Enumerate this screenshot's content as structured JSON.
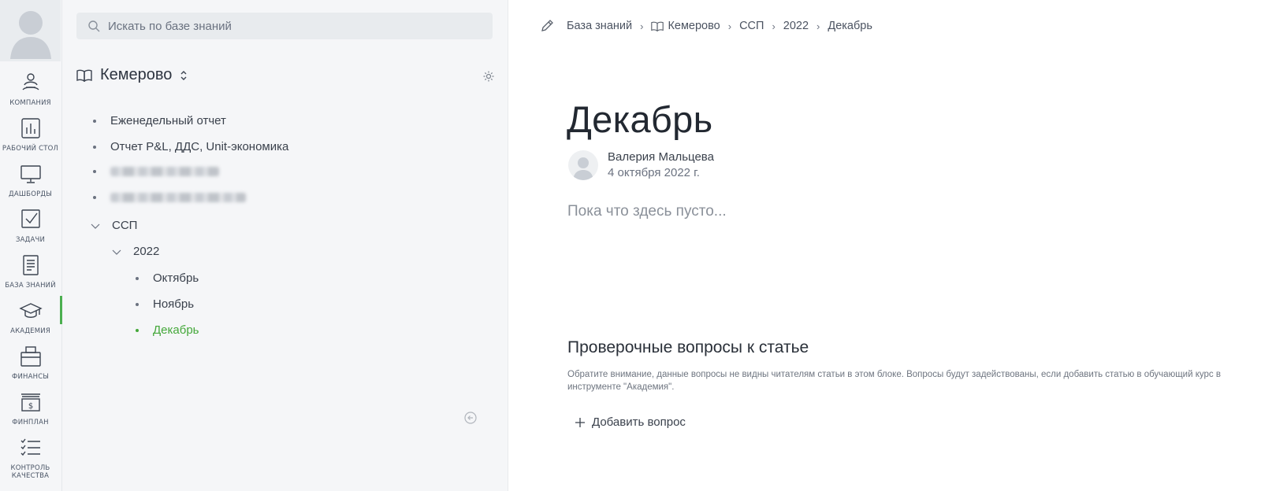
{
  "rail": {
    "items": [
      {
        "label": "КОМПАНИЯ",
        "icon": "company-icon"
      },
      {
        "label": "РАБОЧИЙ СТОЛ",
        "icon": "desktop-chart-icon"
      },
      {
        "label": "ДАШБОРДЫ",
        "icon": "monitor-icon"
      },
      {
        "label": "ЗАДАЧИ",
        "icon": "checkbox-icon"
      },
      {
        "label": "БАЗА ЗНАНИЙ",
        "icon": "document-icon"
      },
      {
        "label": "АКАДЕМИЯ",
        "icon": "graduation-cap-icon"
      },
      {
        "label": "ФИНАНСЫ",
        "icon": "wallet-icon"
      },
      {
        "label": "ФИНПЛАН",
        "icon": "money-stack-icon"
      },
      {
        "label": "КОНТРОЛЬ КАЧЕСТВА",
        "icon": "checklist-icon"
      }
    ],
    "active_index": 5
  },
  "tree": {
    "search_placeholder": "Искать по базе знаний",
    "space_name": "Кемерово",
    "items": [
      {
        "label": "Еженедельный отчет"
      },
      {
        "label": "Отчет P&L, ДДС, Unit-экономика"
      },
      {
        "label": "",
        "blurred": true
      },
      {
        "label": "",
        "blurred": true
      },
      {
        "label": "ССП"
      },
      {
        "label": "2022"
      },
      {
        "label": "Октябрь"
      },
      {
        "label": "Ноябрь"
      },
      {
        "label": "Декабрь",
        "active": true
      }
    ]
  },
  "breadcrumb": {
    "root": "База знаний",
    "space": "Кемерово",
    "folder": "ССП",
    "year": "2022",
    "current": "Декабрь",
    "separator": "›"
  },
  "article": {
    "title": "Декабрь",
    "author_name": "Валерия Мальцева",
    "date": "4 октября 2022 г.",
    "empty_text": "Пока что здесь пусто..."
  },
  "questions": {
    "title": "Проверочные вопросы к статье",
    "note": "Обратите внимание, данные вопросы не видны читателям статьи в этом блоке. Вопросы будут задействованы, если добавить статью в обучающий курс в инструменте \"Академия\".",
    "add_label": "Добавить вопрос"
  },
  "colors": {
    "accent_green": "#44a83a",
    "panel_bg": "#f5f6f8"
  }
}
